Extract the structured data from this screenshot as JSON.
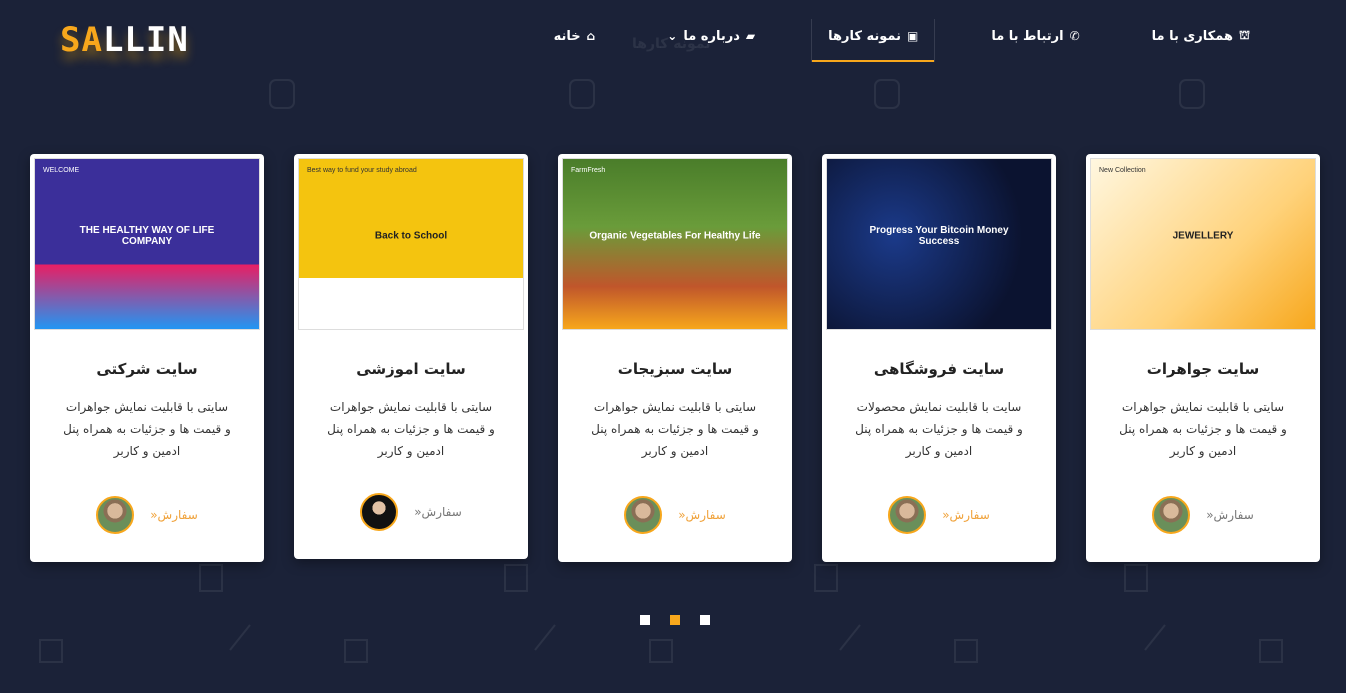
{
  "logo": {
    "accent": "SA",
    "rest": "LLIN"
  },
  "nav": {
    "items": [
      {
        "label": "همکاری با ما",
        "icon": "store-icon",
        "glyph": "⛫",
        "active": false
      },
      {
        "label": "ارتباط با ما",
        "icon": "phone-icon",
        "glyph": "✆",
        "active": false
      },
      {
        "label": "نمونه کارها",
        "icon": "portfolio-icon",
        "glyph": "▣",
        "active": true
      },
      {
        "label": "درباره ما",
        "icon": "book-icon",
        "glyph": "▰",
        "active": false,
        "dropdown": true
      },
      {
        "label": "خانه",
        "icon": "home-icon",
        "glyph": "⌂",
        "active": false
      }
    ],
    "ghost_title": "نمونه کارها"
  },
  "cards": [
    {
      "title": "سایت جواهرات",
      "desc": [
        "سایتی با قابلیت نمایش جواهرات",
        "و قیمت ها و جزئیات به همراه پنل",
        "ادمین و کاربر"
      ],
      "order": "سفارش",
      "thumb_heading": "JEWELLERY",
      "thumb_sub": "New Collection",
      "muted": true
    },
    {
      "title": "سایت فروشگاهی",
      "desc": [
        "سایت با قابلیت نمایش محصولات",
        "و قیمت ها و جزئیات به همراه پنل",
        "ادمین و کاربر"
      ],
      "order": "سفارش",
      "thumb_heading": "Progress Your Bitcoin Money Success",
      "thumb_sub": "",
      "muted": false
    },
    {
      "title": "سایت سبزیجات",
      "desc": [
        "سایتی با قابلیت نمایش جواهرات",
        "و قیمت ها و جزئیات به همراه پنل",
        "ادمین و کاربر"
      ],
      "order": "سفارش",
      "thumb_heading": "Organic Vegetables For Healthy Life",
      "thumb_sub": "FarmFresh",
      "muted": false
    },
    {
      "title": "سایت اموزشی",
      "desc": [
        "سایتی با قابلیت نمایش جواهرات",
        "و قیمت ها و جزئیات به همراه پنل",
        "ادمین و کاربر"
      ],
      "order": "سفارش",
      "thumb_heading": "Back to School",
      "thumb_sub": "Best way to fund your study abroad",
      "muted": true
    },
    {
      "title": "سایت شرکتی",
      "desc": [
        "سایتی با قابلیت نمایش جواهرات",
        "و قیمت ها و جزئیات به همراه پنل",
        "ادمین و کاربر"
      ],
      "order": "سفارش",
      "thumb_heading": "THE HEALTHY WAY OF LIFE COMPANY",
      "thumb_sub": "WELCOME",
      "muted": false
    }
  ],
  "slider": {
    "count": 3,
    "active_index": 1
  },
  "colors": {
    "accent": "#f7a71c",
    "background": "#1b2238"
  }
}
